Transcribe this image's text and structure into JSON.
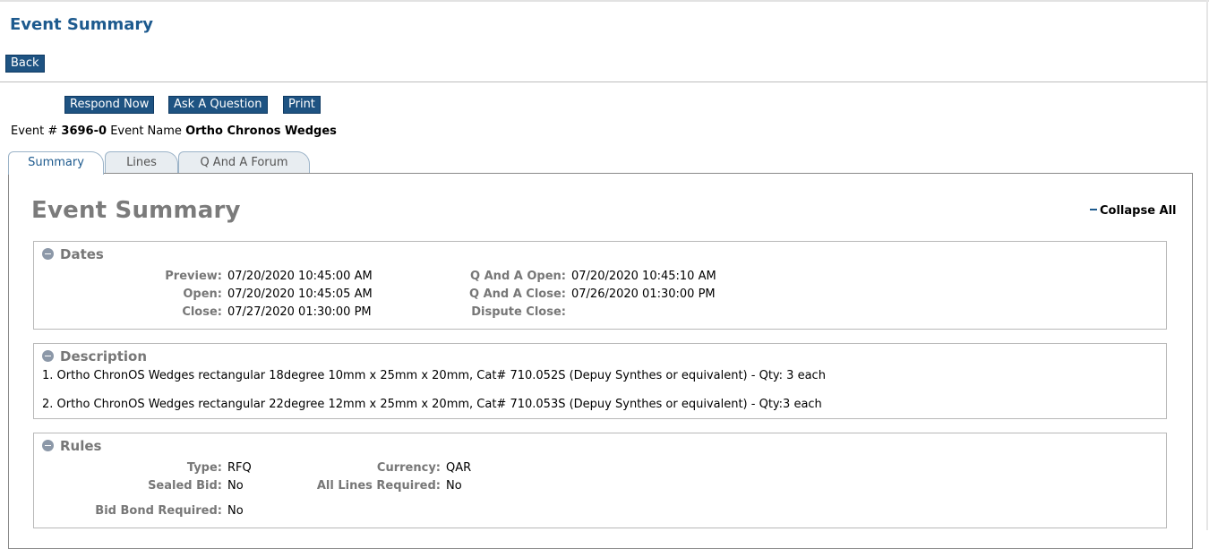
{
  "page": {
    "title": "Event Summary"
  },
  "nav": {
    "back_label": "Back"
  },
  "actions": {
    "respond_label": "Respond Now",
    "ask_label": "Ask A Question",
    "print_label": "Print"
  },
  "event": {
    "number_label": "Event #",
    "number": "3696-0",
    "name_label": "Event Name",
    "name": "Ortho Chronos Wedges"
  },
  "tabs": [
    {
      "label": "Summary",
      "active": true
    },
    {
      "label": "Lines",
      "active": false
    },
    {
      "label": "Q And A Forum",
      "active": false
    }
  ],
  "summary": {
    "heading": "Event Summary",
    "collapse_label": "Collapse All"
  },
  "dates": {
    "title": "Dates",
    "preview_label": "Preview:",
    "preview": "07/20/2020 10:45:00 AM",
    "open_label": "Open:",
    "open": "07/20/2020 10:45:05 AM",
    "close_label": "Close:",
    "close": "07/27/2020 01:30:00 PM",
    "qa_open_label": "Q And A Open:",
    "qa_open": "07/20/2020 10:45:10 AM",
    "qa_close_label": "Q And A Close:",
    "qa_close": "07/26/2020 01:30:00 PM",
    "dispute_close_label": "Dispute Close:",
    "dispute_close": ""
  },
  "description": {
    "title": "Description",
    "lines": [
      "1. Ortho ChronOS Wedges rectangular 18degree 10mm x 25mm x 20mm, Cat# 710.052S (Depuy Synthes or equivalent) - Qty: 3 each",
      "2. Ortho ChronOS Wedges rectangular 22degree 12mm x 25mm x 20mm, Cat# 710.053S (Depuy Synthes or equivalent) - Qty:3 each"
    ]
  },
  "rules": {
    "title": "Rules",
    "type_label": "Type:",
    "type": "RFQ",
    "sealed_label": "Sealed Bid:",
    "sealed": "No",
    "bond_label": "Bid Bond Required:",
    "bond": "No",
    "currency_label": "Currency:",
    "currency": "QAR",
    "all_lines_label": "All Lines Required:",
    "all_lines": "No"
  },
  "colors": {
    "accent": "#1d5a8e",
    "button_bg": "#1e5382",
    "label_gray": "#777777"
  }
}
